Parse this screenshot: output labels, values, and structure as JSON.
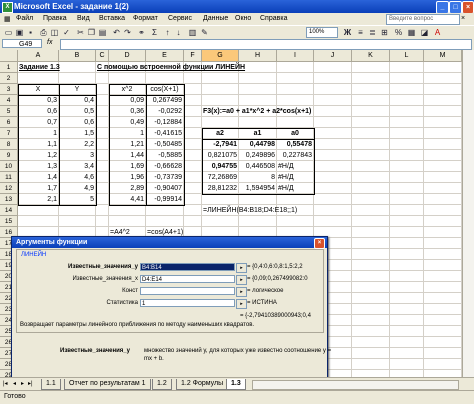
{
  "window": {
    "title": "Microsoft Excel - задание 1(2)"
  },
  "menu": {
    "items": [
      "Файл",
      "Правка",
      "Вид",
      "Вставка",
      "Формат",
      "Сервис",
      "Данные",
      "Окно",
      "Справка"
    ],
    "help_placeholder": "Введите вопрос"
  },
  "toolbar": {
    "zoom": "100%"
  },
  "formula_bar": {
    "name_box": "G49",
    "fx": "fx",
    "content": ""
  },
  "columns": [
    "A",
    "B",
    "C",
    "D",
    "E",
    "F",
    "G",
    "H",
    "I",
    "J",
    "K",
    "L",
    "M"
  ],
  "rows": [
    "1",
    "2",
    "3",
    "4",
    "5",
    "6",
    "7",
    "8",
    "9",
    "10",
    "11",
    "12",
    "13",
    "14",
    "15",
    "16",
    "17",
    "18",
    "19",
    "20",
    "21",
    "22",
    "23",
    "24",
    "25",
    "26",
    "27",
    "28",
    "29"
  ],
  "sheet": {
    "task_title": "Задание 1.3",
    "method_title": "С помощью  встроенной функции ЛИНЕЙН",
    "header_x": "X",
    "header_y": "Y",
    "header_x2": "x^2",
    "header_cos": "cos(X+1)",
    "x": [
      "0,3",
      "0,6",
      "0,7",
      "1",
      "1,1",
      "1,2",
      "1,3",
      "1,4",
      "1,7",
      "2,1"
    ],
    "y": [
      "0,4",
      "0,5",
      "0,6",
      "1,5",
      "2,2",
      "3",
      "3,4",
      "4,6",
      "4,9",
      "5"
    ],
    "x2": [
      "0,09",
      "0,36",
      "0,49",
      "1",
      "1,21",
      "1,44",
      "1,69",
      "1,96",
      "2,89",
      "4,41"
    ],
    "cos": [
      "0,267499",
      "-0,0292",
      "-0,12884",
      "-0,41615",
      "-0,50485",
      "-0,5885",
      "-0,66628",
      "-0,73739",
      "-0,90407",
      "-0,99914"
    ],
    "formula_label": "F3(x):=a0 + a1*x^2 + a2*cos(x+1)",
    "coef_headers": [
      "a2",
      "a1",
      "a0"
    ],
    "coef_table": [
      [
        "-2,7941",
        "0,44798",
        "0,55478"
      ],
      [
        "0,821075",
        "0,249896",
        "0,227843"
      ],
      [
        "0,94755",
        "0,446508",
        "#Н/Д"
      ],
      [
        "72,26869",
        "8",
        "#Н/Д"
      ],
      [
        "28,81232",
        "1,594954",
        "#Н/Д"
      ]
    ],
    "linest_formula": "=ЛИНЕЙН(B4:B18;D4:E18;;1)",
    "note_x2": "=A4^2",
    "note_cos": "=cos(A4+1)"
  },
  "dialog": {
    "title": "Аргументы функции",
    "func_name": "ЛИНЕЙН",
    "args": [
      {
        "label": "Известные_значения_y",
        "value": "B4:B14",
        "result": "= {0,4:0,6:0,8:1,5:2,2"
      },
      {
        "label": "Известные_значения_x",
        "value": "D4:E14",
        "result": "= {0,09;0,267499082:0"
      },
      {
        "label": "Конст",
        "value": "",
        "result": "= логическое"
      },
      {
        "label": "Статистика",
        "value": "1",
        "result": "= ИСТИНА"
      }
    ],
    "total_result": "= {-2,79410389000943;0,4",
    "description": "Возвращает параметры линейного приближения по методу наименьших квадратов.",
    "help_label": "Известные_значения_y",
    "help_text_1": "множество значений y, для которых уже известно соотношение y =",
    "help_text_2": "mx + b."
  },
  "sheet_tabs": [
    "1.1",
    "Отчет по результатам 1",
    "1.2",
    "1.2 Формулы",
    "1.3"
  ],
  "status": {
    "text": "Готово"
  }
}
